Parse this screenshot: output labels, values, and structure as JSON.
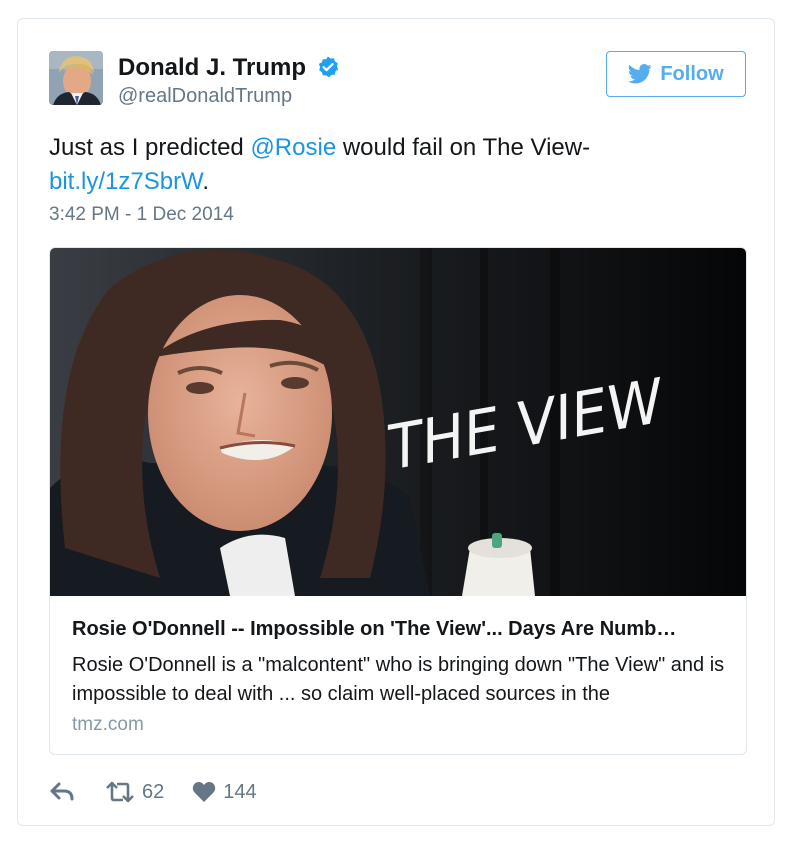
{
  "tweet": {
    "display_name": "Donald J. Trump",
    "handle": "@realDonaldTrump",
    "verified_icon": "verified-badge-icon",
    "follow_label": "Follow",
    "follow_icon": "twitter-bird-icon",
    "text_before": "Just as I predicted ",
    "mention": "@Rosie",
    "text_after": " would fail on The View-",
    "link": "bit.ly/1z7SbrW",
    "link_suffix": ".",
    "timestamp": "3:42 PM - 1 Dec 2014"
  },
  "card": {
    "image_text": "THE VIEW",
    "title": "Rosie O'Donnell -- Impossible on 'The View'... Days Are Numb…",
    "description": "Rosie O'Donnell is a \"malcontent\" who is bringing down \"The View\" and is impossible to deal with ... so claim well-placed sources in the",
    "domain": "tmz.com"
  },
  "actions": {
    "reply_icon": "reply-icon",
    "retweet_icon": "retweet-icon",
    "retweet_count": "62",
    "like_icon": "heart-icon",
    "like_count": "144"
  },
  "colors": {
    "accent": "#55acee",
    "link": "#1b95e0",
    "secondary_text": "#657786",
    "border": "#e1e8ed"
  }
}
